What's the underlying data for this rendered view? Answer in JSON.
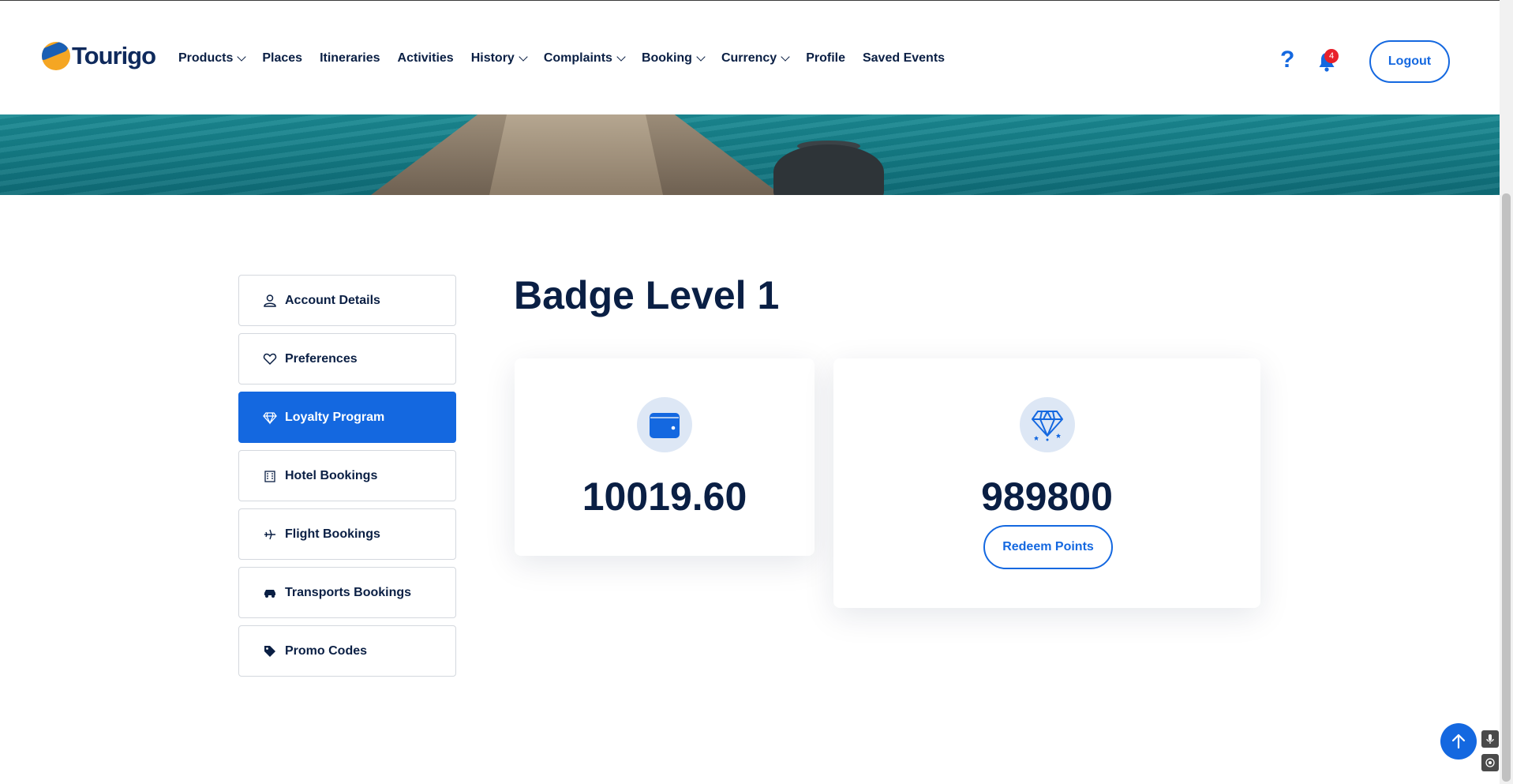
{
  "brand": {
    "name": "Tourigo"
  },
  "nav": {
    "items": [
      {
        "label": "Products",
        "dropdown": true
      },
      {
        "label": "Places",
        "dropdown": false
      },
      {
        "label": "Itineraries",
        "dropdown": false
      },
      {
        "label": "Activities",
        "dropdown": false
      },
      {
        "label": "History",
        "dropdown": true
      },
      {
        "label": "Complaints",
        "dropdown": true
      },
      {
        "label": "Booking",
        "dropdown": true
      },
      {
        "label": "Currency",
        "dropdown": true
      },
      {
        "label": "Profile",
        "dropdown": false
      },
      {
        "label": "Saved Events",
        "dropdown": false
      }
    ]
  },
  "header": {
    "help_symbol": "?",
    "notification_count": "4",
    "logout_label": "Logout"
  },
  "sidebar": {
    "items": [
      {
        "label": "Account Details",
        "icon": "user-icon",
        "active": false
      },
      {
        "label": "Preferences",
        "icon": "heart-icon",
        "active": false
      },
      {
        "label": "Loyalty Program",
        "icon": "diamond-icon",
        "active": true
      },
      {
        "label": "Hotel Bookings",
        "icon": "hotel-icon",
        "active": false
      },
      {
        "label": "Flight Bookings",
        "icon": "plane-icon",
        "active": false
      },
      {
        "label": "Transports Bookings",
        "icon": "car-icon",
        "active": false
      },
      {
        "label": "Promo Codes",
        "icon": "tag-icon",
        "active": false
      }
    ]
  },
  "main": {
    "title": "Badge Level 1",
    "wallet": {
      "value": "10019.60",
      "icon": "wallet-icon"
    },
    "points": {
      "value": "989800",
      "icon": "diamond-icon",
      "redeem_label": "Redeem Points"
    }
  },
  "colors": {
    "accent": "#1468e0",
    "text": "#0a1f44",
    "badge": "#e8202a"
  }
}
